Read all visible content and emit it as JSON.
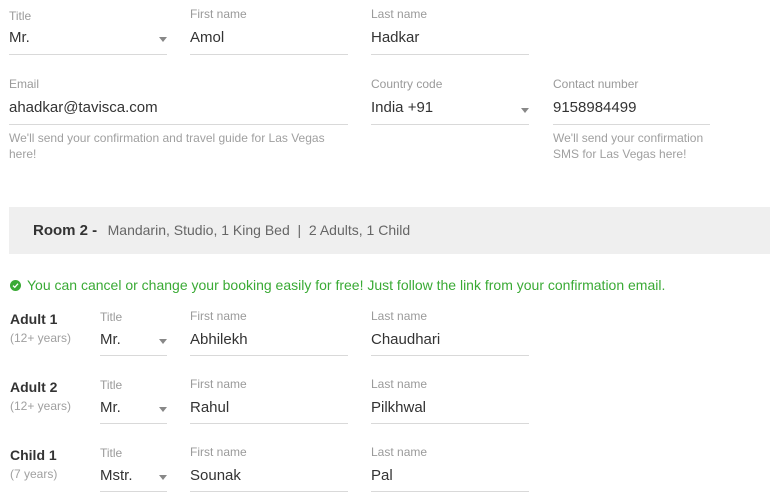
{
  "primary": {
    "title_label": "Title",
    "title_value": "Mr.",
    "first_label": "First name",
    "first_value": "Amol",
    "last_label": "Last name",
    "last_value": "Hadkar",
    "email_label": "Email",
    "email_value": "ahadkar@tavisca.com",
    "email_help": "We'll send your confirmation and travel guide for Las Vegas here!",
    "country_label": "Country code",
    "country_value": "India +91",
    "contact_label": "Contact number",
    "contact_value": "9158984499",
    "contact_help": "We'll send your confirmation SMS for Las Vegas here!"
  },
  "room": {
    "title": "Room 2 -",
    "details": "Mandarin, Studio, 1 King Bed  |  2 Adults, 1 Child"
  },
  "notice": {
    "text": "You can cancel or change your booking easily for free! Just follow the link from your confirmation email.",
    "icon": "check-circle-icon",
    "color": "#3aaa35"
  },
  "guests": [
    {
      "name": "Adult 1",
      "age": "(12+ years)",
      "title_label": "Title",
      "title_value": "Mr.",
      "first_label": "First name",
      "first_value": "Abhilekh",
      "last_label": "Last name",
      "last_value": "Chaudhari"
    },
    {
      "name": "Adult 2",
      "age": "(12+ years)",
      "title_label": "Title",
      "title_value": "Mr.",
      "first_label": "First name",
      "first_value": "Rahul",
      "last_label": "Last name",
      "last_value": "Pilkhwal"
    },
    {
      "name": "Child 1",
      "age": "(7 years)",
      "title_label": "Title",
      "title_value": "Mstr.",
      "first_label": "First name",
      "first_value": "Sounak",
      "last_label": "Last name",
      "last_value": "Pal"
    }
  ]
}
